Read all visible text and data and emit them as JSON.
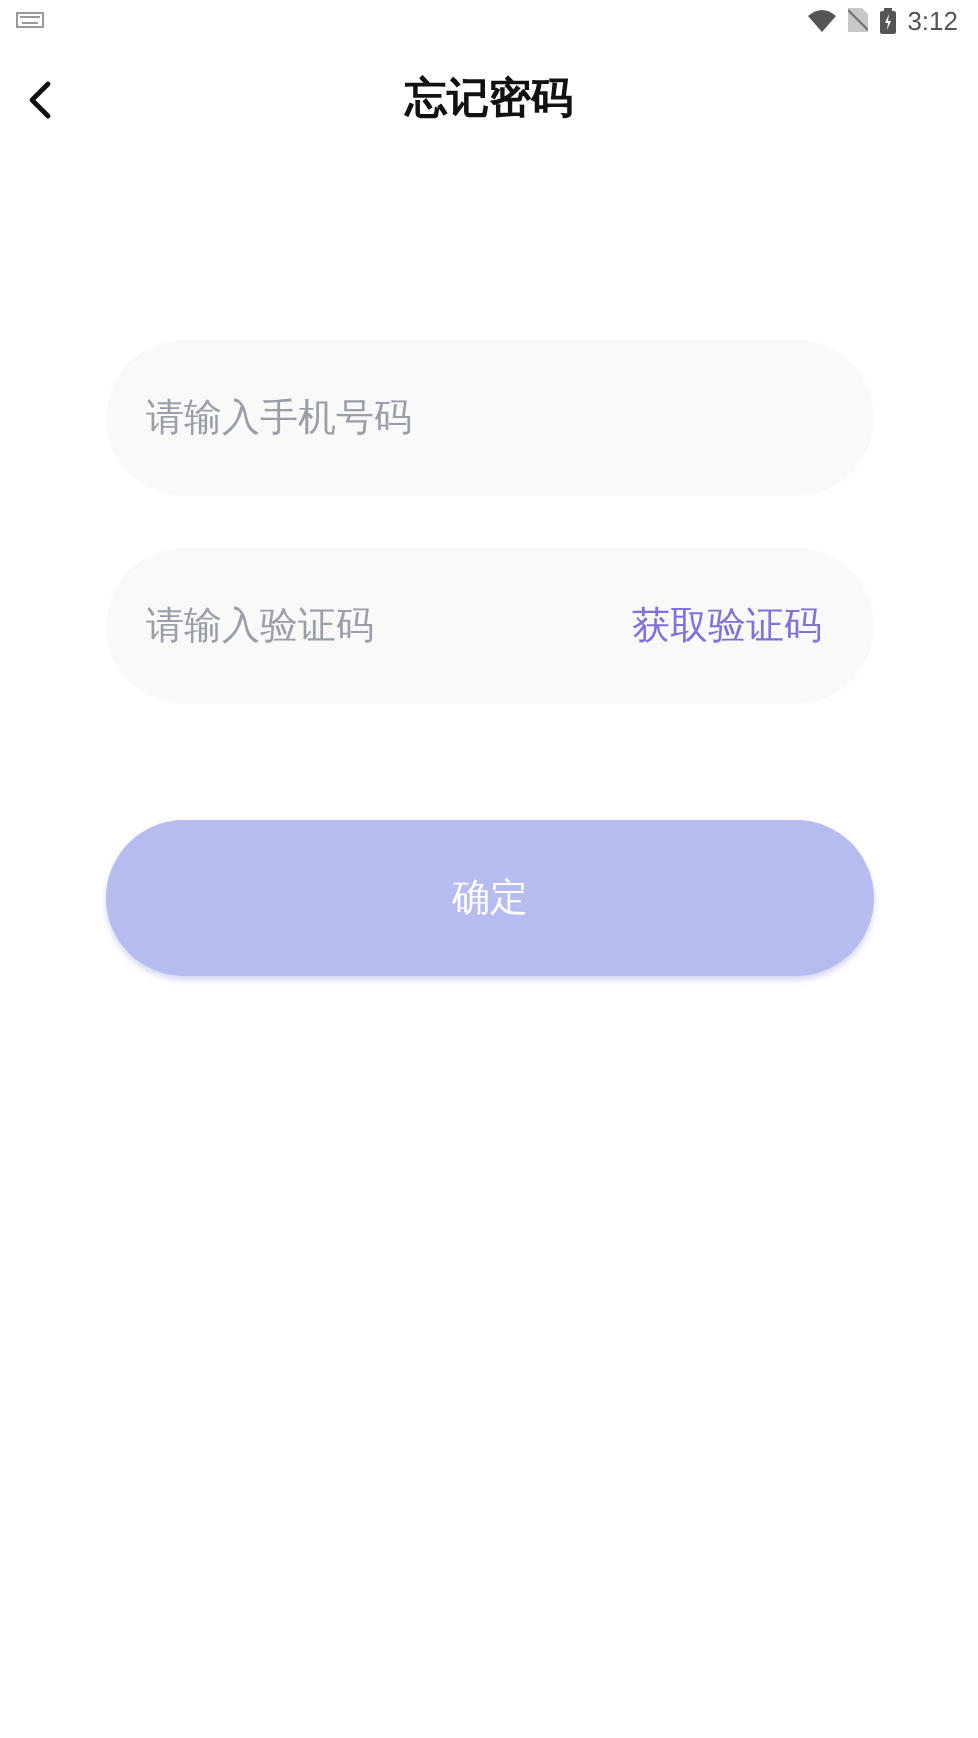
{
  "status_bar": {
    "time": "3:12"
  },
  "header": {
    "title": "忘记密码"
  },
  "form": {
    "phone_field": {
      "placeholder": "请输入手机号码"
    },
    "code_field": {
      "placeholder": "请输入验证码",
      "action": "获取验证码"
    },
    "confirm_button": {
      "label": "确定",
      "disabled": true
    }
  }
}
